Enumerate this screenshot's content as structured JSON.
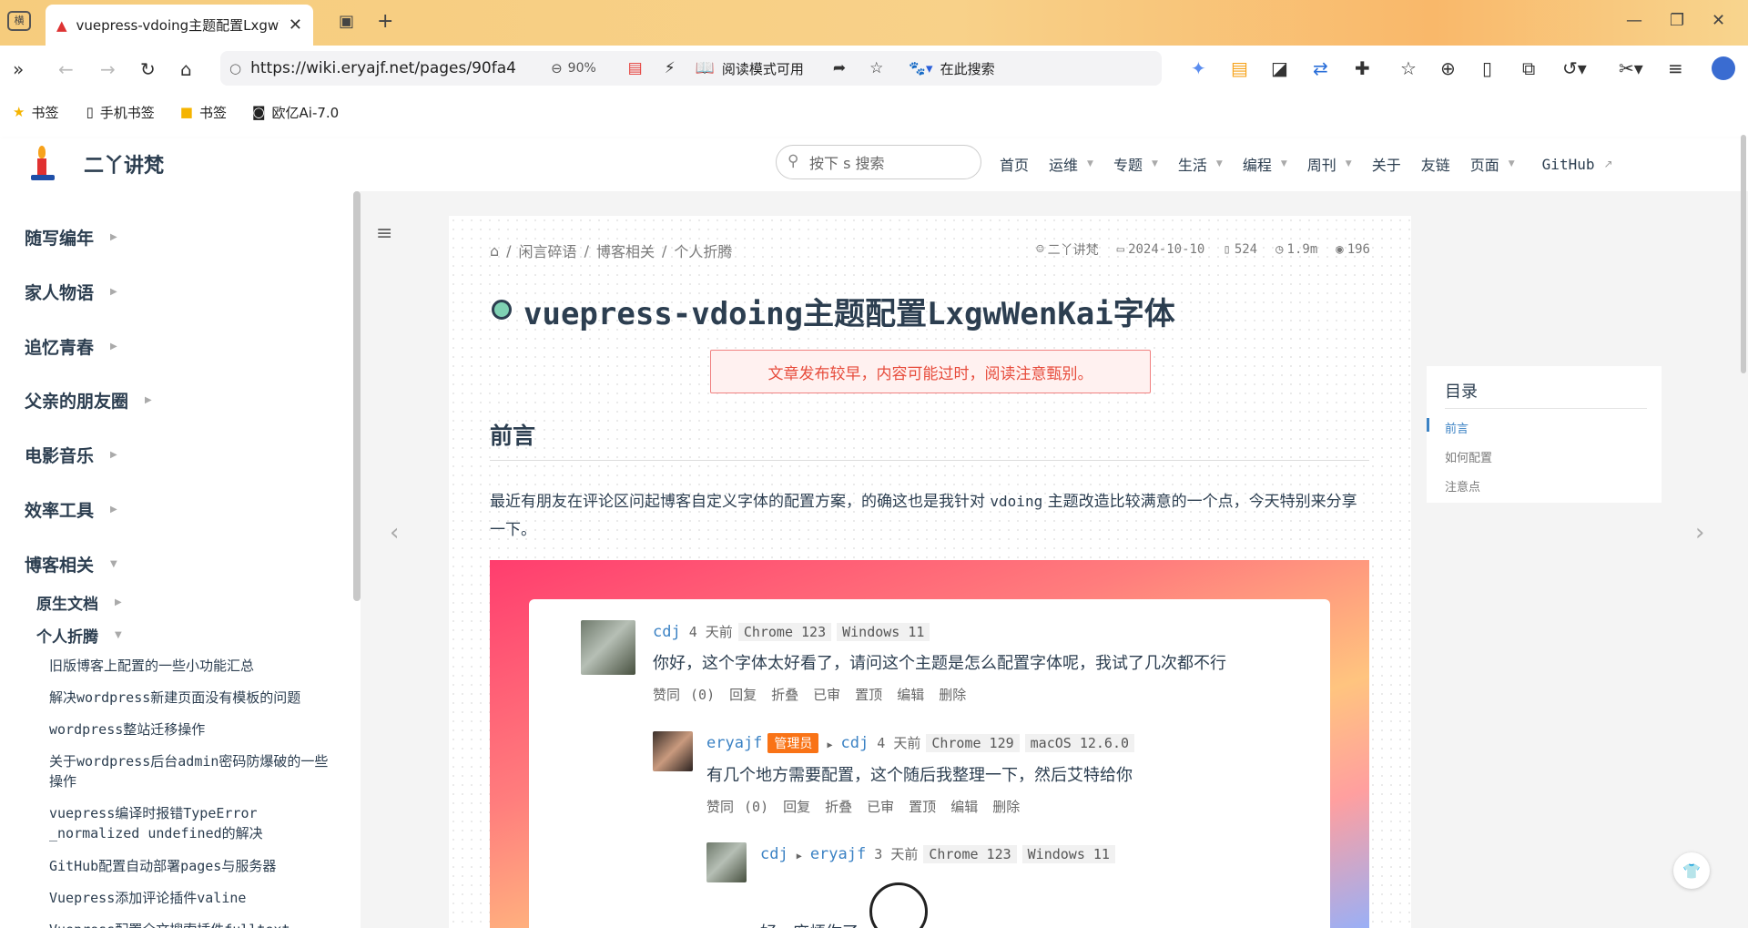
{
  "browser": {
    "tab_title": "vuepress-vdoing主题配置LxgwWenKai字体",
    "tab_sidebar_label": "横",
    "url": "https://wiki.eryajf.net/pages/90fa4",
    "zoom": "90%",
    "reader_mode": "阅读模式可用",
    "search_placeholder": "在此搜索"
  },
  "bookmarks": [
    {
      "label": "书签",
      "icon": "star-icon"
    },
    {
      "label": "手机书签",
      "icon": "phone-icon"
    },
    {
      "label": "书签",
      "icon": "folder-icon"
    },
    {
      "label": "欧亿Ai-7.0",
      "icon": "ai-icon"
    }
  ],
  "site": {
    "title": "二丫讲梵",
    "search_placeholder": "按下 s 搜索",
    "nav": [
      {
        "label": "首页",
        "dropdown": false
      },
      {
        "label": "运维",
        "dropdown": true
      },
      {
        "label": "专题",
        "dropdown": true
      },
      {
        "label": "生活",
        "dropdown": true
      },
      {
        "label": "编程",
        "dropdown": true
      },
      {
        "label": "周刊",
        "dropdown": true
      },
      {
        "label": "关于",
        "dropdown": false
      },
      {
        "label": "友链",
        "dropdown": false
      },
      {
        "label": "页面",
        "dropdown": true
      },
      {
        "label": "GitHub",
        "dropdown": false
      }
    ]
  },
  "sidebar": {
    "groups": [
      "随写编年",
      "家人物语",
      "追忆青春",
      "父亲的朋友圈",
      "电影音乐",
      "效率工具",
      "博客相关"
    ],
    "subgroups": [
      "原生文档",
      "个人折腾"
    ],
    "links": [
      "旧版博客上配置的一些小功能汇总",
      "解决wordpress新建页面没有模板的问题",
      "wordpress整站迁移操作",
      "关于wordpress后台admin密码防爆破的一些操作",
      "vuepress编译时报错TypeError _normalized undefined的解决",
      "GitHub配置自动部署pages与服务器",
      "Vuepress添加评论插件valine",
      "Vuepress配置全文搜索插件fulltext"
    ]
  },
  "article": {
    "breadcrumb": [
      "闲言碎语",
      "博客相关",
      "个人折腾"
    ],
    "meta": {
      "author": "二丫讲梵",
      "date": "2024-10-10",
      "words": "524",
      "read_time": "1.9m",
      "views": "196"
    },
    "title": "vuepress-vdoing主题配置LxgwWenKai字体",
    "warning": "文章发布较早，内容可能过时，阅读注意甄别。",
    "h2": "前言",
    "para_a": "最近有朋友在评论区问起博客自定义字体的配置方案，的确这也是我针对 ",
    "para_code": "vdoing",
    "para_b": " 主题改造比较满意的一个点，今天特别来分享一下。"
  },
  "comments": [
    {
      "user": "cdj",
      "time": "4 天前",
      "browser": "Chrome 123",
      "os": "Windows 11",
      "text": "你好，这个字体太好看了，请问这个主题是怎么配置字体呢，我试了几次都不行",
      "actions": [
        "赞同 (0)",
        "回复",
        "折叠",
        "已审",
        "置顶",
        "编辑",
        "删除"
      ]
    },
    {
      "user": "eryajf",
      "badge": "管理员",
      "reply_to": "cdj",
      "time": "4 天前",
      "browser": "Chrome 129",
      "os": "macOS 12.6.0",
      "text": "有几个地方需要配置，这个随后我整理一下，然后艾特给你",
      "actions": [
        "赞同 (0)",
        "回复",
        "折叠",
        "已审",
        "置顶",
        "编辑",
        "删除"
      ]
    },
    {
      "user": "cdj",
      "reply_to": "eryajf",
      "time": "3 天前",
      "browser": "Chrome 123",
      "os": "Windows 11",
      "text": "好，麻烦你了"
    }
  ],
  "toc": {
    "title": "目录",
    "items": [
      "前言",
      "如何配置",
      "注意点"
    ]
  }
}
